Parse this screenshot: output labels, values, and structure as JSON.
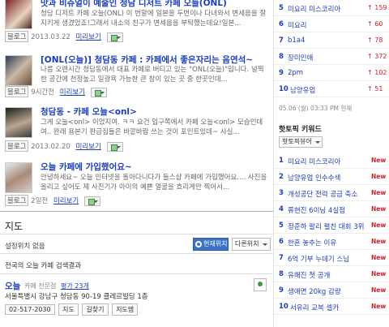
{
  "posts": [
    {
      "title": "맛과 비쥬얼이 예술인 청담 디저트 카페 오늘(ONL)",
      "desc": "청담 디저트 카페 오늘(ONL) 이 번말에 일본을 두번이나 다녀와서 변세음을 잘 지키게 생겼었죠!그래서 내소의 친구가 변세음을 부탁했는데요!일본...",
      "type": "블로그",
      "date": "2013.03.22",
      "preview": "미리보기"
    },
    {
      "title": "[ONL(오늘)] 청담동 카페 : 카페에서 좋은자리는 음연석~",
      "desc": "나름 오랜시간 청담동에서 대표 카페로 버티고 있는 \"ONL(오늘)\"입니다. 널찍한 공간에 천정높고 일광욕 가능한 큰 창이 있는 곳 중 한곳인데...",
      "type": "블로그",
      "date": "9시간전",
      "preview": "미리보기"
    },
    {
      "title": "청담동 - 카페 오늘<onl>",
      "desc": "그게 오늘<onl> 이었지여. ㅋㅋ 요건 입구쪽에서 카페 오늘<onl> 모습인데여.. 완래 용본기 판금집들은 바깥바람 쓰는 것이 포인트있데~ 사실...",
      "type": "블로그",
      "date": "2013.02.20",
      "preview": "미리보기"
    },
    {
      "title": "오늘 카페에 가입했어요~",
      "desc": "안녕하세요~ 오늘 인터넷을 돌아다니다가 들스샵 카페에 가입했어요.... 사진을 올리고 싶어도 제 사진기가 아이의 예쁜 얼굴을 흐리게만 찍어서...",
      "type": "블로그",
      "date": "2일전",
      "preview": "미리보기"
    }
  ],
  "map": {
    "title": "지도",
    "location_label": "설정위치 없음",
    "current_location_btn": "현재위치",
    "other_location_btn": "다른위치",
    "result_heading": "전국의 오늘 카페 검색결과"
  },
  "business": {
    "name": "오늘",
    "category": "카페 전문점",
    "reviews": "평가 23개",
    "address": "서울특별시 강남구 청담동 90-19 클레르빌딩 1층",
    "phone": "02-517-2030",
    "btn_map": "지도",
    "btn_route": "길찾기",
    "btn_mapview": "지도맵"
  },
  "realtime_rank": [
    {
      "rank": "5",
      "keyword": "미요리 미스코리아",
      "change": "↑ 159"
    },
    {
      "rank": "6",
      "keyword": "미요리",
      "change": "↑ 60"
    },
    {
      "rank": "7",
      "keyword": "b1a4",
      "change": "↑ 78"
    },
    {
      "rank": "8",
      "keyword": "장미인애",
      "change": "↑ 372"
    },
    {
      "rank": "9",
      "keyword": "2pm",
      "change": "↑ 102"
    },
    {
      "rank": "10",
      "keyword": "남양유업",
      "change": "↑ 51"
    }
  ],
  "rank_time": "05.06 (월) 03:33 PM 현재",
  "hot_title": "핫토픽 키워드",
  "hot_dropdown": "핫토픽뷰어",
  "hot_keywords": [
    {
      "rank": "1",
      "keyword": "미요리 미스코리아",
      "badge": "New"
    },
    {
      "rank": "2",
      "keyword": "남양유업 인수수색",
      "badge": "New"
    },
    {
      "rank": "3",
      "keyword": "개성공단 전력 공급 축소",
      "badge": "New"
    },
    {
      "rank": "4",
      "keyword": "류현진 6이닝 4실점",
      "badge": "New"
    },
    {
      "rank": "5",
      "keyword": "정준하 팔리 펼친 대회 3위",
      "badge": "New"
    },
    {
      "rank": "6",
      "keyword": "한혼 놓추는 이유",
      "badge": "New"
    },
    {
      "rank": "7",
      "keyword": "6억 기부 누데기 스님",
      "badge": "New"
    },
    {
      "rank": "8",
      "keyword": "유해진 첫 공개",
      "badge": "New"
    },
    {
      "rank": "9",
      "keyword": "생애면 20kg 감량",
      "badge": "New"
    },
    {
      "rank": "10",
      "keyword": "서유리 교복 셀카",
      "badge": "New"
    }
  ]
}
